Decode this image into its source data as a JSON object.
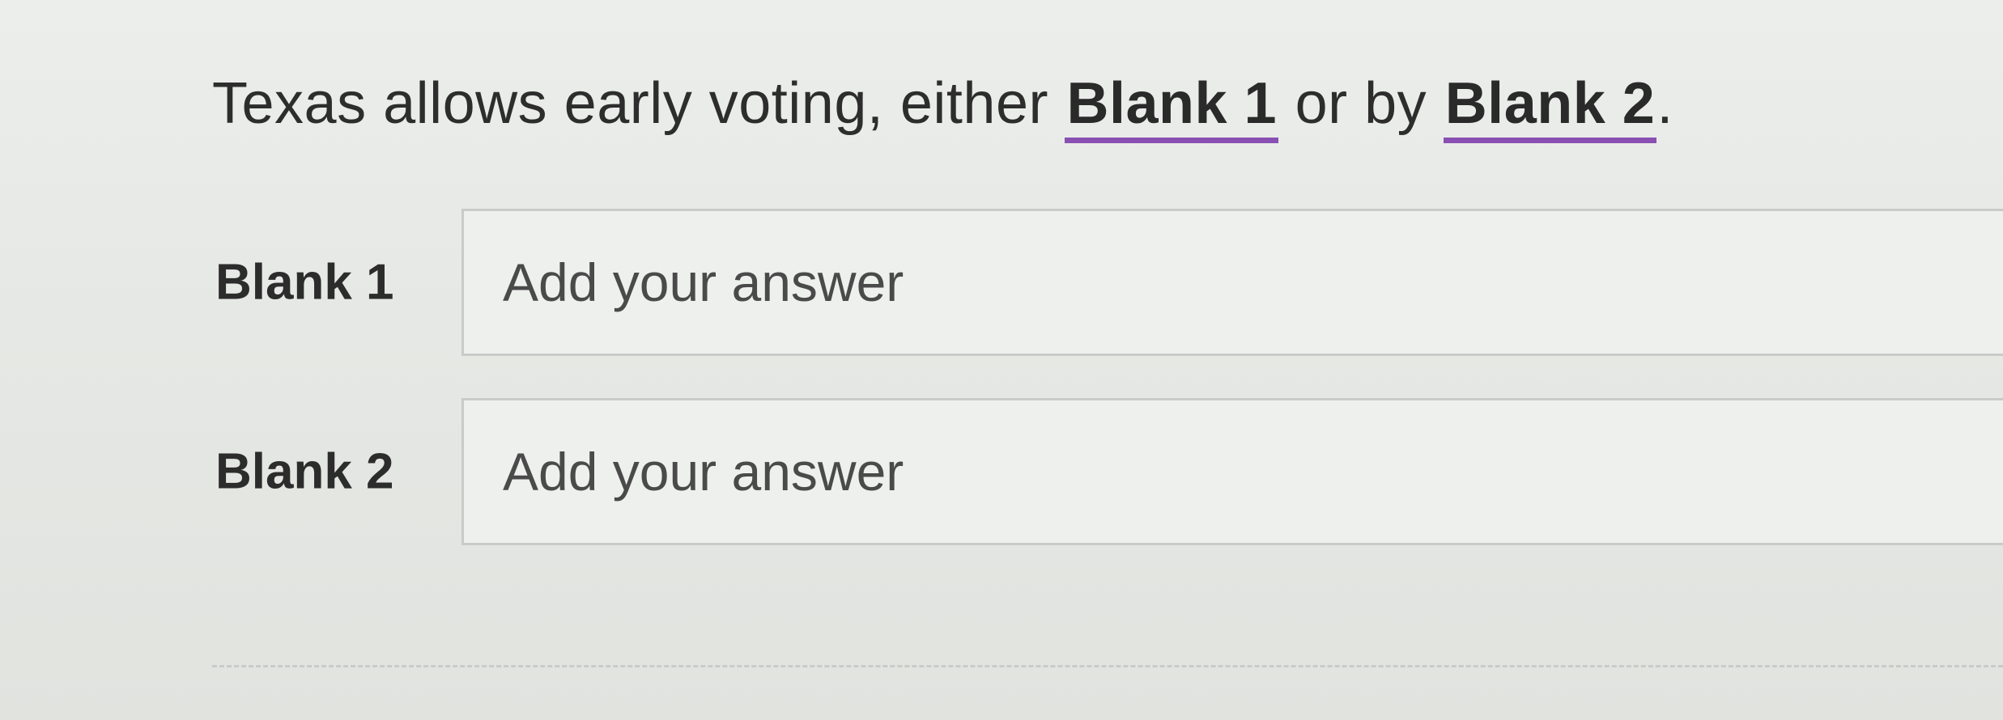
{
  "question": {
    "text_before": "Texas allows early voting, either ",
    "blank1_ref": "Blank 1",
    "text_middle": " or by ",
    "blank2_ref": "Blank 2",
    "text_end": "."
  },
  "blanks": [
    {
      "label": "Blank 1",
      "placeholder": "Add your answer",
      "value": ""
    },
    {
      "label": "Blank 2",
      "placeholder": "Add your answer",
      "value": ""
    }
  ],
  "colors": {
    "blank_underline": "#8a4fb2",
    "background": "#e6e8e5",
    "input_border": "#c9cbc8"
  }
}
